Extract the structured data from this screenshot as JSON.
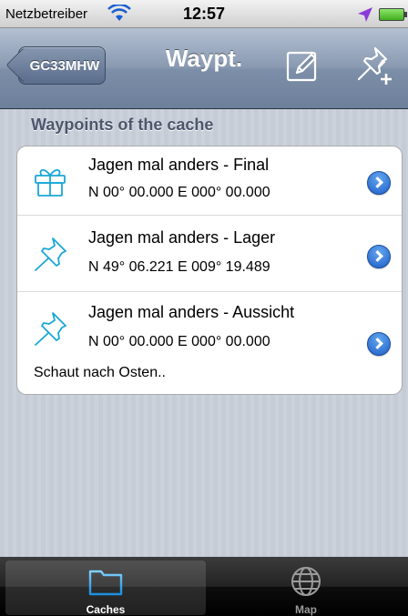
{
  "status_bar": {
    "carrier": "Netzbetreiber",
    "time": "12:57",
    "wifi_icon": "wifi-icon",
    "location_icon": "location-arrow-icon",
    "battery_icon": "battery-icon"
  },
  "nav": {
    "back_label": "GC33MHW",
    "title": "Waypt.",
    "edit_icon": "edit-icon",
    "add_waypoint_icon": "add-pushpin-icon"
  },
  "section": {
    "header": "Waypoints of the cache"
  },
  "waypoints": [
    {
      "icon": "gift-box-icon",
      "name": "Jagen mal anders - Final",
      "coords": "N 00° 00.000  E 000° 00.000",
      "note": ""
    },
    {
      "icon": "pushpin-icon",
      "name": "Jagen mal anders - Lager",
      "coords": "N 49° 06.221  E 009° 19.489",
      "note": ""
    },
    {
      "icon": "pushpin-icon",
      "name": "Jagen mal anders - Aussicht",
      "coords": "N 00° 00.000  E 000° 00.000",
      "note": "Schaut nach Osten.."
    }
  ],
  "tabs": [
    {
      "label": "Caches",
      "icon": "folder-icon",
      "selected": true
    },
    {
      "label": "Map",
      "icon": "globe-icon",
      "selected": false
    }
  ],
  "colors": {
    "nav_blue": "#6d7f9a",
    "disclosure_blue": "#1f5fc9",
    "pin_cyan": "#1aa7d6",
    "section_text": "#4c566c"
  }
}
